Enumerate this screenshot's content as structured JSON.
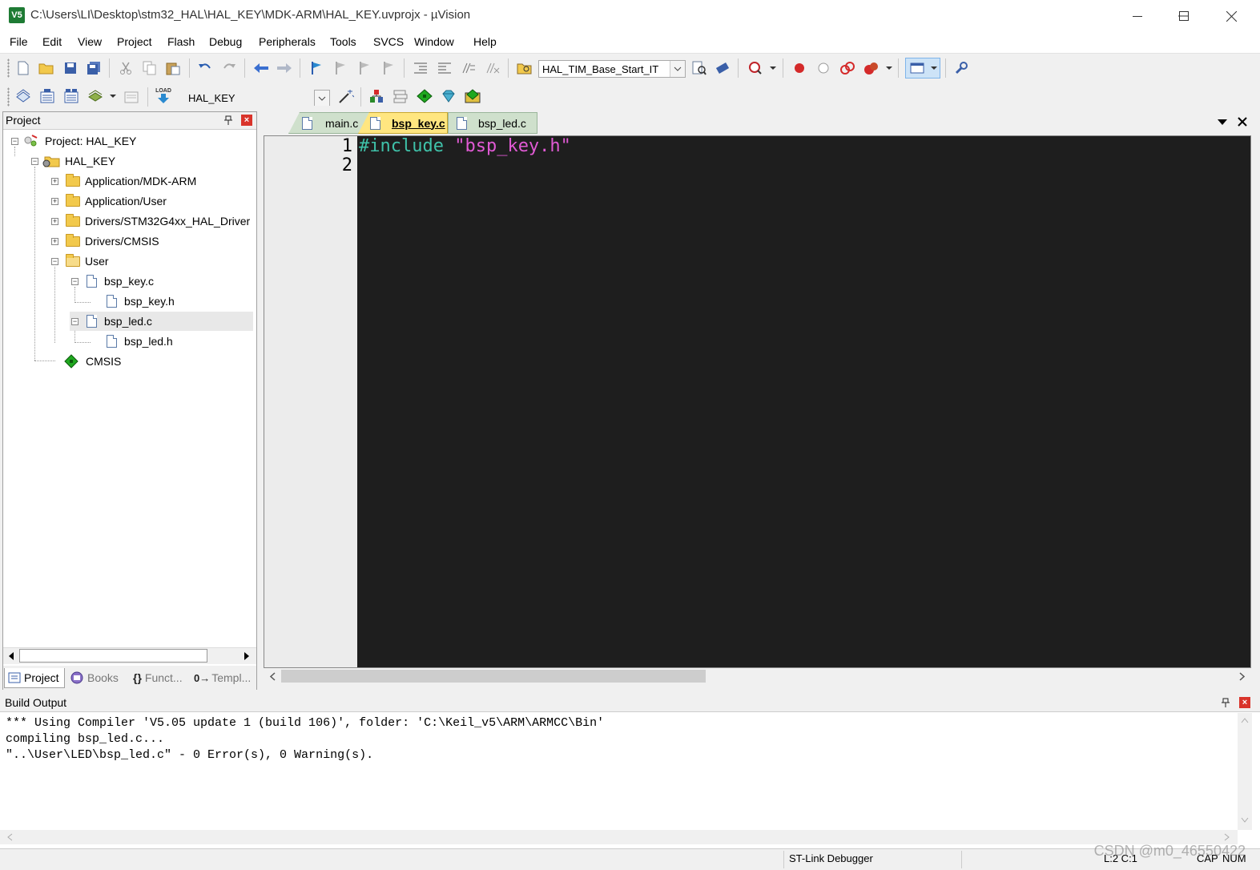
{
  "window": {
    "title": "C:\\Users\\LI\\Desktop\\stm32_HAL\\HAL_KEY\\MDK-ARM\\HAL_KEY.uvprojx - µVision",
    "app_icon_text": "V5"
  },
  "menu": [
    "File",
    "Edit",
    "View",
    "Project",
    "Flash",
    "Debug",
    "Peripherals",
    "Tools",
    "SVCS",
    "Window",
    "Help"
  ],
  "toolbar1": {
    "find_combo_value": "HAL_TIM_Base_Start_IT"
  },
  "toolbar2": {
    "target_combo_value": "HAL_KEY",
    "load_label": "LOAD"
  },
  "project_panel": {
    "title": "Project",
    "tree": {
      "root": "Project: HAL_KEY",
      "target": "HAL_KEY",
      "groups": [
        "Application/MDK-ARM",
        "Application/User",
        "Drivers/STM32G4xx_HAL_Driver",
        "Drivers/CMSIS",
        "User"
      ],
      "user_files": [
        "bsp_key.c",
        "bsp_key.h",
        "bsp_led.c",
        "bsp_led.h"
      ],
      "cmsis": "CMSIS"
    },
    "tabs": [
      "Project",
      "Books",
      "Funct...",
      "Templ..."
    ],
    "tab_icons": [
      "{}",
      "0→"
    ]
  },
  "editor": {
    "tabs": [
      "main.c",
      "bsp_key.c",
      "bsp_led.c"
    ],
    "active_tab": "bsp_key.c",
    "line_numbers": [
      "1",
      "2"
    ],
    "code": {
      "directive": "#include",
      "string": "\"bsp_key.h\""
    },
    "colors": {
      "background": "#1e1e1e",
      "directive": "#3fc1a9",
      "string": "#e05ad4",
      "active_tab": "#ffe680",
      "inactive_tab": "#cfe0cc"
    }
  },
  "build_output": {
    "title": "Build Output",
    "lines": [
      "*** Using Compiler 'V5.05 update 1 (build 106)', folder: 'C:\\Keil_v5\\ARM\\ARMCC\\Bin'",
      "compiling bsp_led.c...",
      "\"..\\User\\LED\\bsp_led.c\" - 0 Error(s), 0 Warning(s)."
    ]
  },
  "statusbar": {
    "debugger": "ST-Link Debugger",
    "position": "L:2 C:1",
    "caps": "CAP",
    "num": "NUM"
  },
  "watermark": "CSDN @m0_46550422"
}
